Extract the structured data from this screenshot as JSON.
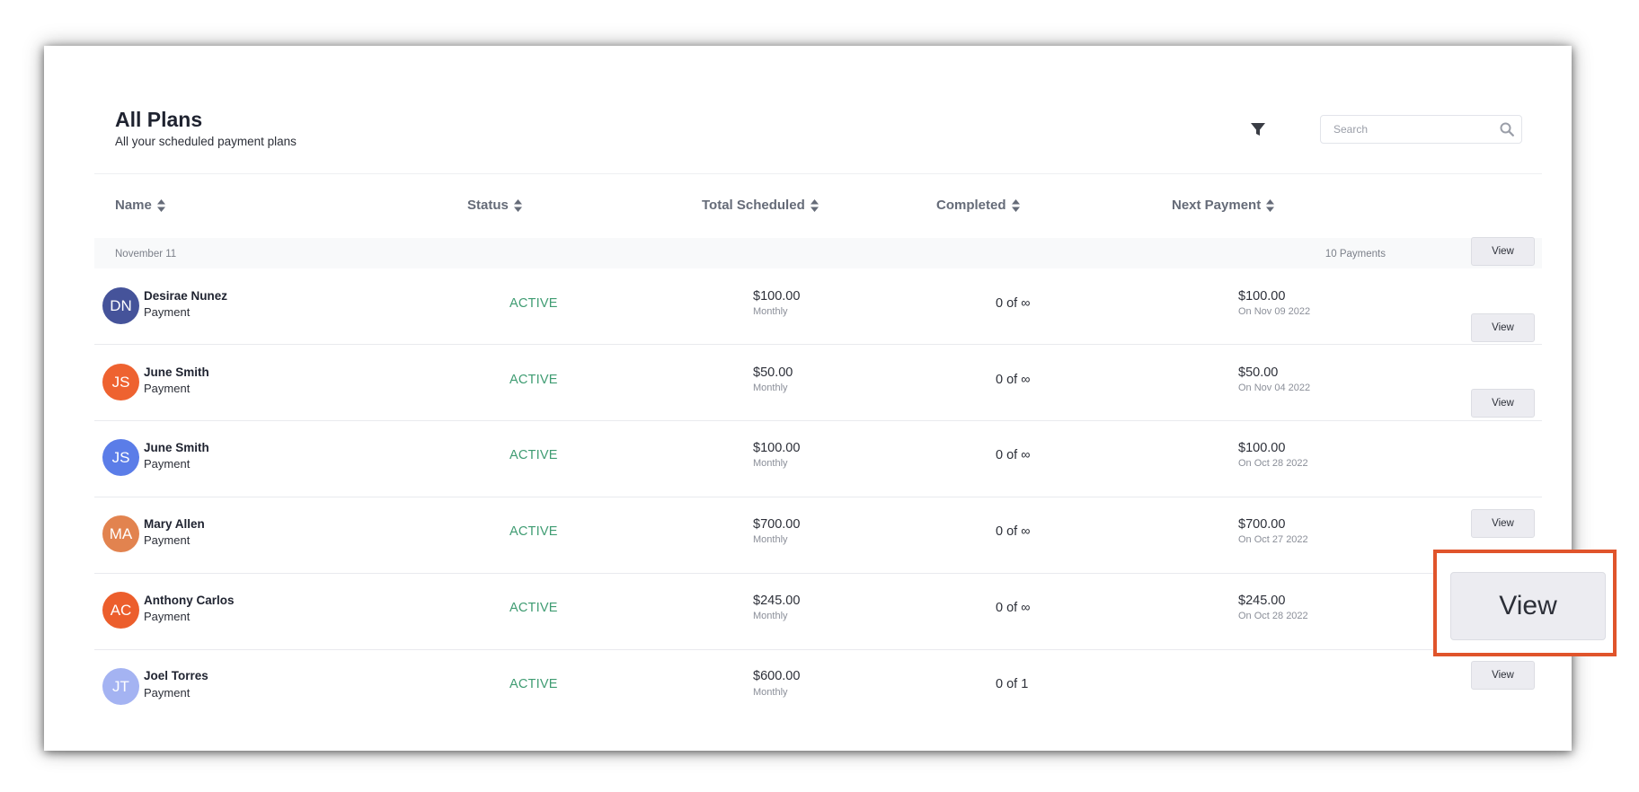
{
  "header": {
    "title": "All Plans",
    "subtitle": "All your scheduled payment plans"
  },
  "search": {
    "placeholder": "Search",
    "value": ""
  },
  "icons": {
    "filter": "filter-icon",
    "search": "search-icon",
    "sort": "sort-icon"
  },
  "columns": {
    "name": "Name",
    "status": "Status",
    "total": "Total Scheduled",
    "completed": "Completed",
    "next": "Next Payment"
  },
  "group": {
    "date": "November 11",
    "count": "10 Payments"
  },
  "rows": [
    {
      "initials": "DN",
      "avatar_color": "#45539a",
      "name": "Desirae Nunez",
      "type": "Payment",
      "status": "ACTIVE",
      "amount": "$100.00",
      "frequency": "Monthly",
      "completed": "0 of ∞",
      "next_amount": "$100.00",
      "next_date": "On Nov 09 2022",
      "action": "View"
    },
    {
      "initials": "JS",
      "avatar_color": "#ee6230",
      "name": "June Smith",
      "type": "Payment",
      "status": "ACTIVE",
      "amount": "$50.00",
      "frequency": "Monthly",
      "completed": "0 of ∞",
      "next_amount": "$50.00",
      "next_date": "On Nov 04 2022",
      "action": "View"
    },
    {
      "initials": "JS",
      "avatar_color": "#5b7de8",
      "name": "June Smith",
      "type": "Payment",
      "status": "ACTIVE",
      "amount": "$100.00",
      "frequency": "Monthly",
      "completed": "0 of ∞",
      "next_amount": "$100.00",
      "next_date": "On Oct 28 2022",
      "action": "View"
    },
    {
      "initials": "MA",
      "avatar_color": "#e2834f",
      "name": "Mary Allen",
      "type": "Payment",
      "status": "ACTIVE",
      "amount": "$700.00",
      "frequency": "Monthly",
      "completed": "0 of ∞",
      "next_amount": "$700.00",
      "next_date": "On Oct 27 2022",
      "action": "View"
    },
    {
      "initials": "AC",
      "avatar_color": "#ec5e2c",
      "name": "Anthony Carlos",
      "type": "Payment",
      "status": "ACTIVE",
      "amount": "$245.00",
      "frequency": "Monthly",
      "completed": "0 of ∞",
      "next_amount": "$245.00",
      "next_date": "On Oct 28 2022",
      "action": "View"
    },
    {
      "initials": "JT",
      "avatar_color": "#a4b3f2",
      "name": "Joel Torres",
      "type": "Payment",
      "status": "ACTIVE",
      "amount": "$600.00",
      "frequency": "Monthly",
      "completed": "0 of 1",
      "next_amount": "",
      "next_date": "",
      "action": "View"
    }
  ],
  "callout": {
    "label": "View",
    "border_color": "#e0542b"
  },
  "colors": {
    "status_active": "#3f9c72",
    "button_bg": "#ececf1",
    "text_primary": "#1f2330",
    "text_muted": "#8b8f99"
  }
}
